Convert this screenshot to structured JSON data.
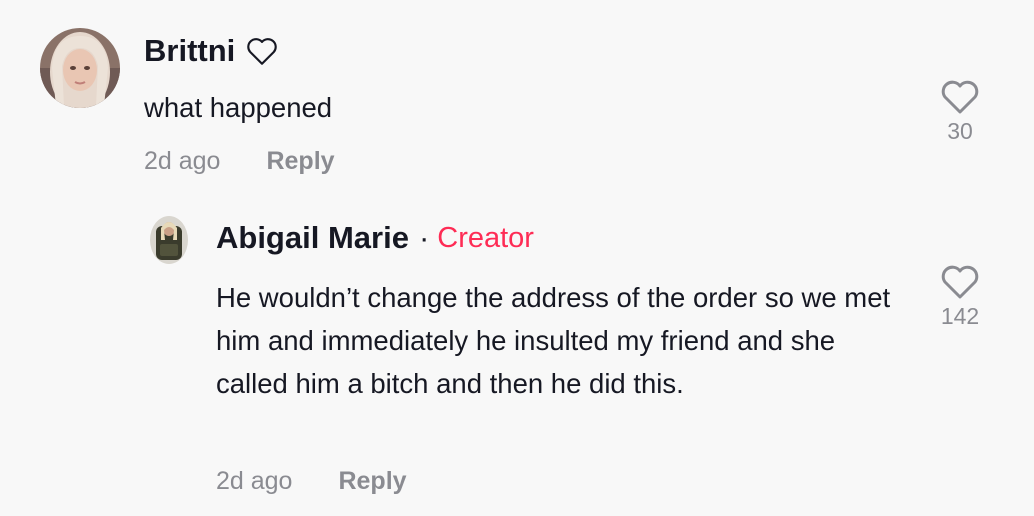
{
  "comments": [
    {
      "username": "Brittni",
      "text": "what happened",
      "time": "2d ago",
      "reply_label": "Reply",
      "likes": "30"
    }
  ],
  "replies": [
    {
      "username": "Abigail Marie",
      "separator": "·",
      "badge": "Creator",
      "text": "He wouldn’t change the address of the order so we met him and immediately he insulted my friend and she called him a bitch and then he did this.",
      "time": "2d ago",
      "reply_label": "Reply",
      "likes": "142"
    }
  ],
  "colors": {
    "background": "#f8f8f8",
    "text": "#161823",
    "muted": "#8a8b91",
    "creator_accent": "#fe2c55"
  },
  "icons": {
    "like": "heart-outline-icon",
    "username_decoration": "heart-outline-icon"
  }
}
